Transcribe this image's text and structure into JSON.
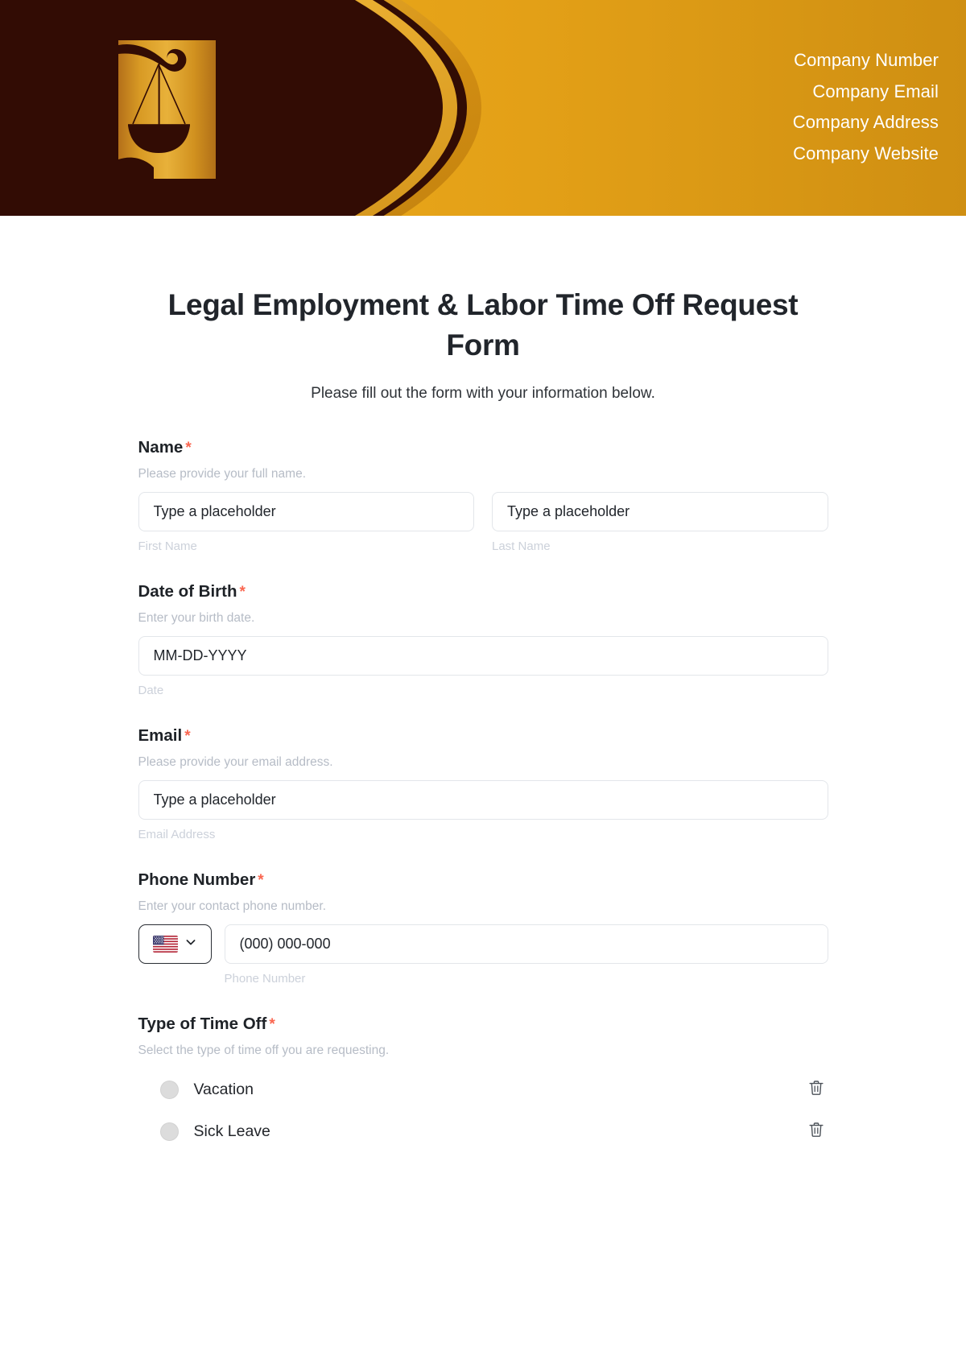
{
  "banner": {
    "logo_alt": "scales-of-justice-logo",
    "contacts": [
      "Company Number",
      "Company Email",
      "Company Address",
      "Company Website"
    ],
    "colors": {
      "dark": "#320c04",
      "gold": "#e8a317",
      "gold_light": "#ffe9a8"
    }
  },
  "form": {
    "title": "Legal Employment & Labor Time Off Request Form",
    "subtitle": "Please fill out the form with your information below.",
    "required_marker": "*",
    "required_color": "#fa6650",
    "fields": {
      "name": {
        "label": "Name",
        "description": "Please provide your full name.",
        "first": {
          "placeholder": "Type a placeholder",
          "value": "",
          "sublabel": "First Name"
        },
        "last": {
          "placeholder": "Type a placeholder",
          "value": "",
          "sublabel": "Last Name"
        }
      },
      "dob": {
        "label": "Date of Birth",
        "description": "Enter your birth date.",
        "placeholder": "MM-DD-YYYY",
        "value": "",
        "sublabel": "Date"
      },
      "email": {
        "label": "Email",
        "description": "Please provide your email address.",
        "placeholder": "Type a placeholder",
        "value": "",
        "sublabel": "Email Address"
      },
      "phone": {
        "label": "Phone Number",
        "description": "Enter your contact phone number.",
        "country_flag": "us-flag",
        "country_code_selected": "US",
        "placeholder": "(000) 000-000",
        "value": "",
        "sublabel": "Phone Number"
      },
      "time_off_type": {
        "label": "Type of Time Off",
        "description": "Select the type of time off you are requesting.",
        "options": [
          {
            "label": "Vacation",
            "selected": false,
            "delete_icon": "trash-icon"
          },
          {
            "label": "Sick Leave",
            "selected": false,
            "delete_icon": "trash-icon"
          }
        ]
      }
    }
  }
}
